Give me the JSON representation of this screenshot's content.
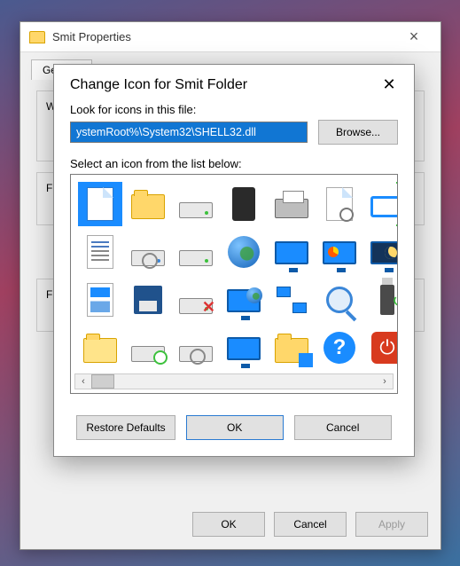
{
  "props": {
    "title": "Smit Properties",
    "tabs": {
      "general": "General"
    },
    "panel_w_label": "W",
    "panel_f1_label": "F",
    "panel_f2_label": "F",
    "ok": "OK",
    "cancel": "Cancel",
    "apply": "Apply"
  },
  "ci": {
    "title": "Change Icon for Smit Folder",
    "look_label": "Look for icons in this file:",
    "path_value": "ystemRoot%\\System32\\SHELL32.dll",
    "browse": "Browse...",
    "select_label": "Select an icon from the list below:",
    "restore": "Restore Defaults",
    "ok": "OK",
    "cancel": "Cancel",
    "icons": [
      "blank-document",
      "folder",
      "hard-drive",
      "chip",
      "printer",
      "document-clock",
      "run-window",
      "text-document",
      "drive-optical",
      "drive-eco",
      "globe",
      "monitor",
      "monitor-chart",
      "monitor-night",
      "list-document",
      "floppy",
      "drive-error",
      "network-monitor",
      "network-link",
      "magnifier",
      "usb-eject",
      "folder-open",
      "drive-plus",
      "drive-opt2",
      "monitor-blank",
      "folder-apps",
      "help",
      "power"
    ],
    "selected_index": 0
  }
}
